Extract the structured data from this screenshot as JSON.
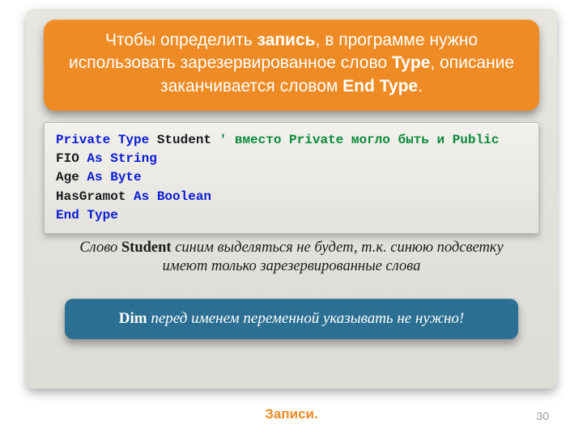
{
  "header": {
    "line1_before_bold": "Чтобы определить ",
    "bold1": "запись",
    "line1_after_bold": ", в программе нужно использовать зарезервированное слово ",
    "bold2": "Type",
    "line2_mid": ", описание заканчивается словом ",
    "bold3": "End Type",
    "end": "."
  },
  "code": {
    "l1_kw1": "Private Type",
    "l1_name": " Student   ",
    "l1_cmt": "' вместо Private могло быть и Public",
    "l2_indent": "   FIO ",
    "l2_kw": "As String",
    "l3_indent": "   Age ",
    "l3_kw": "As Byte",
    "l4_indent": "   HasGramot ",
    "l4_kw": "As Boolean",
    "l5_kw": "End Type"
  },
  "note": {
    "pre": "Слово ",
    "bold": "Student",
    "post": " синим выделяться не будет, т.к. синюю подсветку имеют только зарезервированные слова"
  },
  "bluebox": {
    "bold": "Dim",
    "rest": " перед именем переменной указывать не нужно!"
  },
  "footer": {
    "title": "Записи.",
    "page": "30"
  }
}
